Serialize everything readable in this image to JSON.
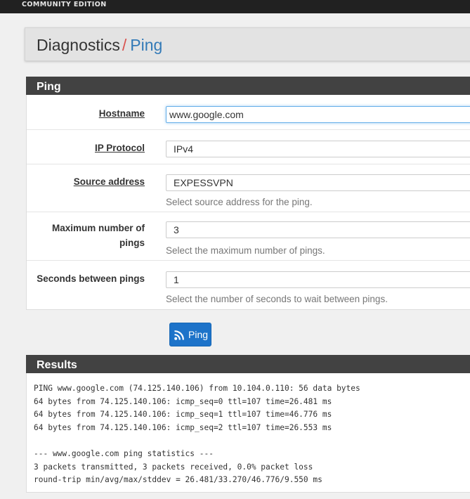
{
  "header": {
    "edition": "COMMUNITY EDITION"
  },
  "breadcrumb": {
    "section": "Diagnostics",
    "separator": "/",
    "page": "Ping"
  },
  "ping_panel": {
    "title": "Ping",
    "hostname": {
      "label": "Hostname",
      "value": "www.google.com"
    },
    "ip_protocol": {
      "label": "IP Protocol",
      "value": "IPv4"
    },
    "source_address": {
      "label": "Source address",
      "value": "EXPESSVPN",
      "help": "Select source address for the ping."
    },
    "max_pings": {
      "label": "Maximum number of pings",
      "value": "3",
      "help": "Select the maximum number of pings."
    },
    "seconds_between": {
      "label": "Seconds between pings",
      "value": "1",
      "help": "Select the number of seconds to wait between pings."
    }
  },
  "ping_button": {
    "label": "Ping",
    "icon": "rss-icon"
  },
  "results_panel": {
    "title": "Results",
    "lines": [
      "PING www.google.com (74.125.140.106) from 10.104.0.110: 56 data bytes",
      "64 bytes from 74.125.140.106: icmp_seq=0 ttl=107 time=26.481 ms",
      "64 bytes from 74.125.140.106: icmp_seq=1 ttl=107 time=46.776 ms",
      "64 bytes from 74.125.140.106: icmp_seq=2 ttl=107 time=26.553 ms",
      "",
      "--- www.google.com ping statistics ---",
      "3 packets transmitted, 3 packets received, 0.0% packet loss",
      "round-trip min/avg/max/stddev = 26.481/33.270/46.776/9.550 ms"
    ]
  },
  "colors": {
    "header_bg": "#212121",
    "panel_heading": "#424242",
    "accent_link": "#337ab7",
    "separator": "#d9534f",
    "button": "#1d73c9"
  }
}
